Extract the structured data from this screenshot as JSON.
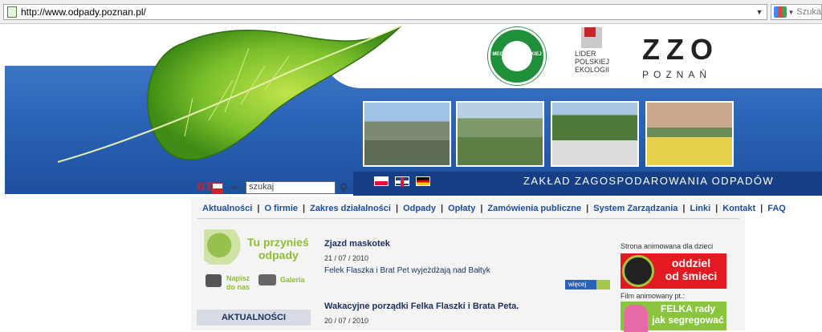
{
  "browser": {
    "url": "http://www.odpady.poznan.pl/",
    "search_placeholder": "Szuka"
  },
  "header": {
    "logo_circle_text": "MECENAS POLSKIEJ EKOLOGII",
    "lider_text": "LIDER POLSKIEJ EKOLOGII",
    "zzo_main": "ZZO",
    "zzo_sub": "POZNAŃ",
    "tagline": "ZAKŁAD ZAGOSPODAROWANIA ODPADÓW"
  },
  "search": {
    "btp_label": "BTP",
    "input_value": "szukaj"
  },
  "nav": {
    "items": [
      "Aktualności",
      "O firmie",
      "Zakres działalności",
      "Odpady",
      "Opłaty",
      "Zamówienia publiczne",
      "System Zarządzania",
      "Linki",
      "Kontakt",
      "FAQ"
    ]
  },
  "left": {
    "tu_line1": "Tu przynieś",
    "tu_line2": "odpady",
    "napisz_line1": "Napisz",
    "napisz_line2": "do nas",
    "galeria": "Galeria",
    "aktualnosci": "AKTUALNOŚCI"
  },
  "news": [
    {
      "title": "Zjazd maskotek",
      "date": "21 / 07 / 2010",
      "text": "Felek Flaszka i Brat Pet wyjeżdżają nad Bałtyk"
    },
    {
      "title": "Wakacyjne porządki Felka Flaszki i Brata Peta.",
      "date": "20 / 07 / 2010"
    }
  ],
  "wiecej": "więcej",
  "right": {
    "strona_label": "Strona animowana dla dzieci",
    "oddziel_line1": "oddziel",
    "oddziel_line2": "od śmieci",
    "film_label": "Film animowany pt.:",
    "felka_line1": "FELKA rady",
    "felka_line2": "jak segregować"
  }
}
